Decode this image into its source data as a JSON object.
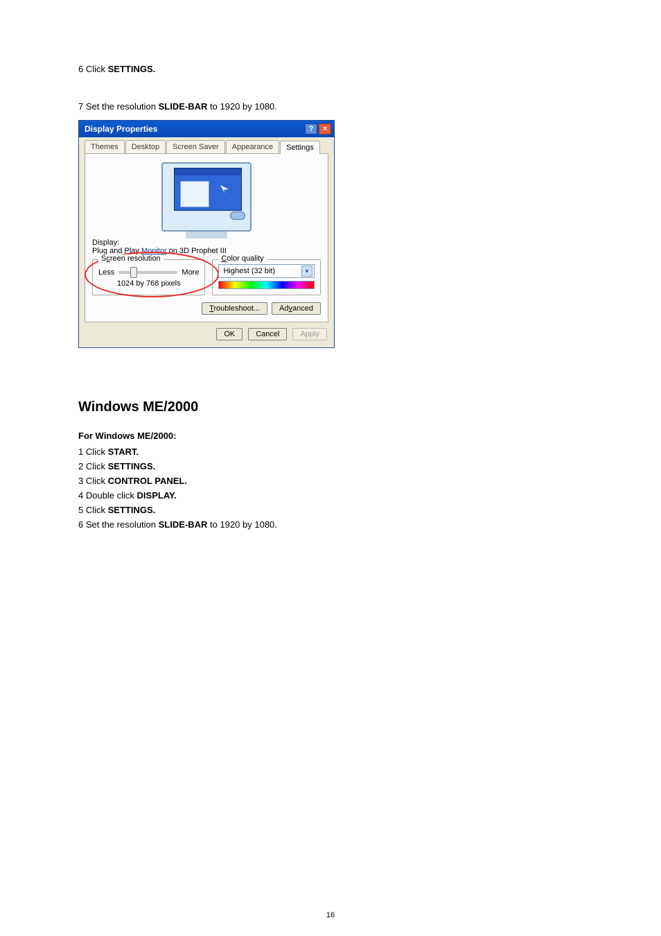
{
  "intro": {
    "step6_prefix": "6 Click ",
    "step6_bold": "SETTINGS.",
    "step7_prefix": "7 Set the resolution ",
    "step7_bold": "SLIDE-BAR",
    "step7_suffix": " to 1920 by 1080."
  },
  "dialog": {
    "title": "Display Properties",
    "help_glyph": "?",
    "close_glyph": "×",
    "tabs": {
      "themes": "Themes",
      "desktop": "Desktop",
      "screensaver": "Screen Saver",
      "appearance": "Appearance",
      "settings": "Settings"
    },
    "display_label": "Display:",
    "display_value_prefix": "Plug and Play ",
    "display_value_link": "Monitor",
    "display_value_suffix": " on 3D Prophet III",
    "groups": {
      "res_legend_pre": "S",
      "res_legend_ul": "c",
      "res_legend_post": "reen resolution",
      "less": "Less",
      "more": "More",
      "res_value": "1024 by 768 pixels",
      "cq_legend_ul": "C",
      "cq_legend_post": "olor quality",
      "cq_value": "Highest (32 bit)"
    },
    "buttons": {
      "troubleshoot_ul": "T",
      "troubleshoot_rest": "roubleshoot...",
      "advanced_pre": "Ad",
      "advanced_ul": "v",
      "advanced_post": "anced",
      "ok": "OK",
      "cancel": "Cancel",
      "apply": "Apply"
    }
  },
  "section": {
    "heading": "Windows ME/2000",
    "subheading": "For Windows ME/2000:",
    "steps": {
      "s1_pre": "1 Click ",
      "s1_bold": "START.",
      "s2_pre": "2 Click ",
      "s2_bold": "SETTINGS.",
      "s3_pre": "3 Click ",
      "s3_bold": "CONTROL PANEL.",
      "s4_pre": "4 Double click ",
      "s4_bold": "DISPLAY.",
      "s5_pre": "5 Click ",
      "s5_bold": "SETTINGS.",
      "s6_pre": "6 Set the resolution ",
      "s6_bold": "SLIDE-BAR",
      "s6_post": " to 1920 by 1080."
    }
  },
  "page_number": "16"
}
